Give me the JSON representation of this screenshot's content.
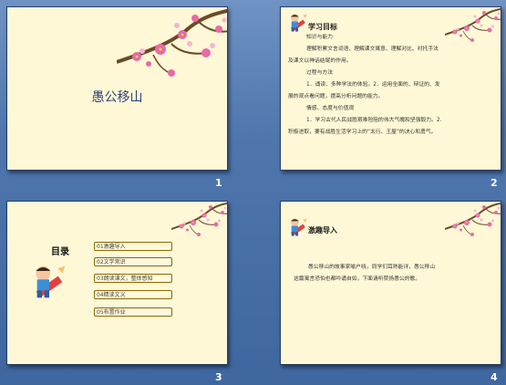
{
  "slides": [
    {
      "number": "1",
      "title": "愚公移山"
    },
    {
      "number": "2",
      "heading": "学习目标",
      "lines": [
        "知识与能力",
        "理解积累文言词语、理解课文寓意、理解对比、衬托手法",
        "及课文以神话结尾的作用。",
        "过程与方法",
        "1．诵读、多种学法的体验。2．运用全面的、辩证的、发",
        "展的观点看问题，提高分析问题的能力。",
        "情感、态度与价值观",
        "1．学习古代人民战胜艰难险阻的伟大气魄和坚强毅力。2.",
        "积极进取，要有战胜生活学习上的“太行、王屋”的决心和勇气。"
      ]
    },
    {
      "number": "3",
      "heading": "目录",
      "items": [
        "01激趣导入",
        "02文学常识",
        "03朗读课文，整体感知",
        "04精读文义",
        "05布置作业"
      ]
    },
    {
      "number": "4",
      "heading": "激趣导入",
      "lines": [
        "愚公移山的故事家喻户晓，同学们耳熟能详，愚公移山",
        "这篇寓言恐怕也都吟诵自如，下面请听赞扬愚公的歌。"
      ]
    }
  ],
  "colors": {
    "slide_bg": "#fff8d6",
    "blossom": "#e86aa8",
    "branch": "#6b4a2a",
    "workspace": "#4f77ae"
  },
  "icons": [
    "plum-blossom-branch",
    "boy-with-pencil"
  ]
}
